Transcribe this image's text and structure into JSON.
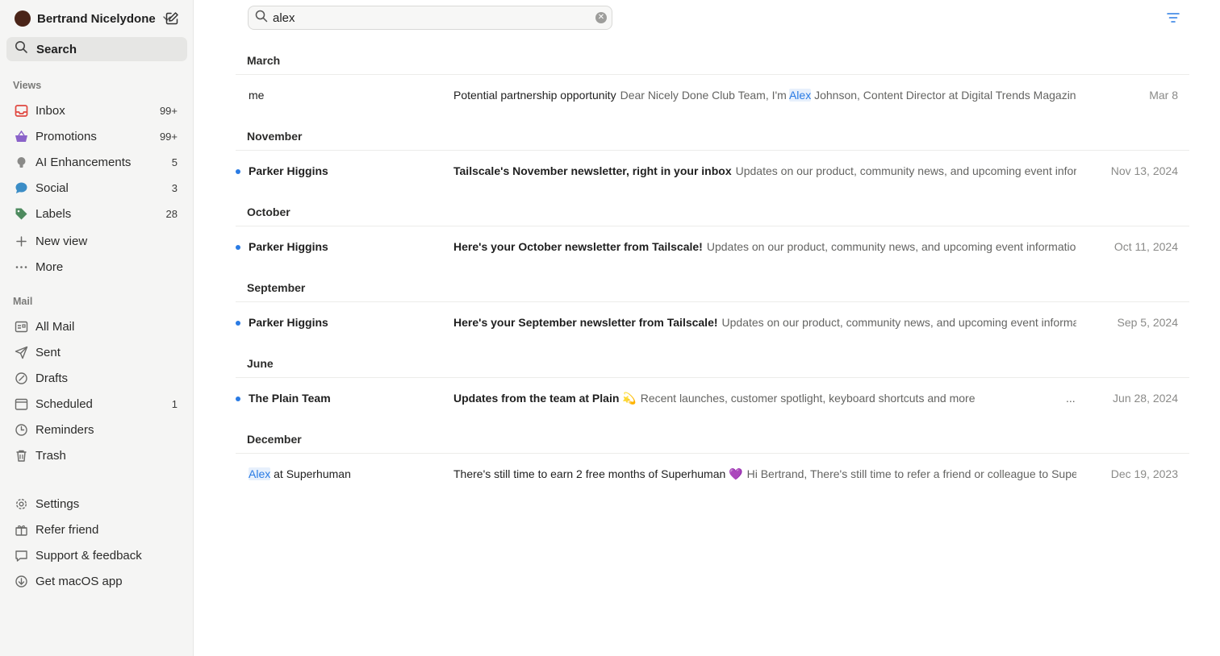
{
  "account": {
    "name": "Bertrand Nicelydone"
  },
  "search_nav": {
    "label": "Search"
  },
  "views": {
    "section_label": "Views",
    "items": [
      {
        "label": "Inbox",
        "count": "99+",
        "icon": "inbox-icon",
        "color": "#e0473f"
      },
      {
        "label": "Promotions",
        "count": "99+",
        "icon": "basket-icon",
        "color": "#8a62c9"
      },
      {
        "label": "AI Enhancements",
        "count": "5",
        "icon": "bulb-icon",
        "color": "#8a8a88"
      },
      {
        "label": "Social",
        "count": "3",
        "icon": "chat-bubble-icon",
        "color": "#3b8dc6"
      },
      {
        "label": "Labels",
        "count": "28",
        "icon": "tag-icon",
        "color": "#4d8a5e"
      },
      {
        "label": "New view",
        "count": "",
        "icon": "plus-icon",
        "color": "#6a6a68"
      },
      {
        "label": "More",
        "count": "",
        "icon": "more-dots-icon",
        "color": "#6a6a68"
      }
    ]
  },
  "mail": {
    "section_label": "Mail",
    "items": [
      {
        "label": "All Mail",
        "count": "",
        "icon": "all-mail-icon"
      },
      {
        "label": "Sent",
        "count": "",
        "icon": "send-icon"
      },
      {
        "label": "Drafts",
        "count": "",
        "icon": "drafts-icon"
      },
      {
        "label": "Scheduled",
        "count": "1",
        "icon": "calendar-icon"
      },
      {
        "label": "Reminders",
        "count": "",
        "icon": "clock-icon"
      },
      {
        "label": "Trash",
        "count": "",
        "icon": "trash-icon"
      }
    ]
  },
  "footer_nav": {
    "items": [
      {
        "label": "Settings",
        "icon": "gear-icon"
      },
      {
        "label": "Refer friend",
        "icon": "gift-icon"
      },
      {
        "label": "Support & feedback",
        "icon": "speech-bubble-icon"
      },
      {
        "label": "Get macOS app",
        "icon": "download-icon"
      }
    ]
  },
  "search": {
    "value": "alex"
  },
  "groups": [
    {
      "label": "March",
      "emails": [
        {
          "sender": "me",
          "unread": false,
          "subject": "Potential partnership opportunity",
          "snippet_pre": "Dear Nicely Done Club Team, I'm ",
          "snippet_hl": "Alex",
          "snippet_post": " Johnson, Content Director at Digital Trends Magazine. ...",
          "date": "Mar 8"
        }
      ]
    },
    {
      "label": "November",
      "emails": [
        {
          "sender": "Parker Higgins",
          "unread": true,
          "subject": "Tailscale's November newsletter, right in your inbox",
          "snippet_pre": "Updates on our product, community news, and upcoming event informati...",
          "snippet_hl": "",
          "snippet_post": "",
          "date": "Nov 13, 2024"
        }
      ]
    },
    {
      "label": "October",
      "emails": [
        {
          "sender": "Parker Higgins",
          "unread": true,
          "subject": "Here's your October newsletter from Tailscale!",
          "snippet_pre": "Updates on our product, community news, and upcoming event information Hi ...",
          "snippet_hl": "",
          "snippet_post": "",
          "date": "Oct 11, 2024"
        }
      ]
    },
    {
      "label": "September",
      "emails": [
        {
          "sender": "Parker Higgins",
          "unread": true,
          "subject": "Here's your September newsletter from Tailscale!",
          "snippet_pre": "Updates on our product, community news, and upcoming event information ...",
          "snippet_hl": "",
          "snippet_post": "",
          "date": "Sep 5, 2024"
        }
      ]
    },
    {
      "label": "June",
      "emails": [
        {
          "sender": "The Plain Team",
          "unread": true,
          "subject": "Updates from the team at Plain 💫",
          "snippet_pre": "Recent launches, customer spotlight, keyboard shortcuts and more",
          "snippet_hl": "",
          "snippet_post": "",
          "trailing": "...",
          "date": "Jun 28, 2024"
        }
      ]
    },
    {
      "label": "December",
      "emails": [
        {
          "sender_hl": "Alex",
          "sender": " at Superhuman",
          "unread": false,
          "subject": "There's still time to earn 2 free months of Superhuman 💜",
          "snippet_pre": "Hi Bertrand, There's still time to refer a friend or colleague to Superh...",
          "snippet_hl": "",
          "snippet_post": "",
          "date": "Dec 19, 2023"
        }
      ]
    }
  ],
  "colors": {
    "accent": "#2a7be4",
    "unread_dot": "#2a7be4"
  }
}
